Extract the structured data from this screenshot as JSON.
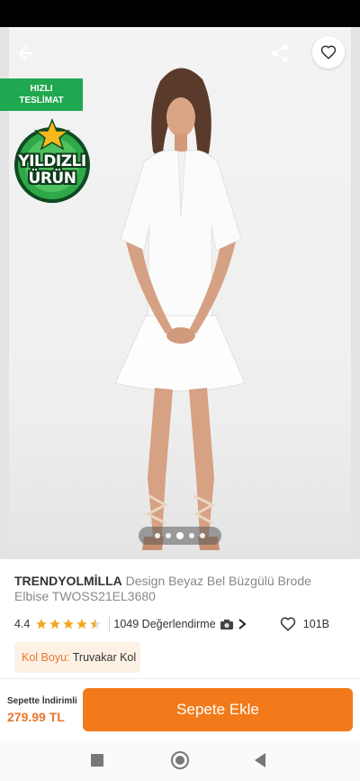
{
  "hero": {
    "fast_delivery_badge": {
      "line1": "HIZLI",
      "line2": "TESLİMAT",
      "color": "#1fa84f"
    },
    "star_badge": {
      "line1": "YILDIZLI",
      "line2": "ÜRÜN"
    },
    "icons": {
      "back": "back-arrow-icon",
      "share": "share-icon",
      "favorite": "heart-icon"
    },
    "pager": {
      "count": 5,
      "active_index": 2
    }
  },
  "product": {
    "brand": "TRENDYOLMİLLA",
    "name": "Design Beyaz Bel Büzgülü Brode Elbise TWOSS21EL3680",
    "rating": "4.4",
    "rating_value": 4.4,
    "reviews": "1049 Değerlendirme",
    "likes": "101B",
    "variant_label": "Kol Boyu:",
    "variant_value": "Truvakar Kol"
  },
  "cart": {
    "discount_label": "Sepette İndirimli",
    "price": "279.99 TL",
    "add_button": "Sepete Ekle",
    "accent": "#f27a1a"
  },
  "navbar": {
    "icons": [
      "recent-apps-icon",
      "home-icon",
      "back-icon"
    ]
  }
}
